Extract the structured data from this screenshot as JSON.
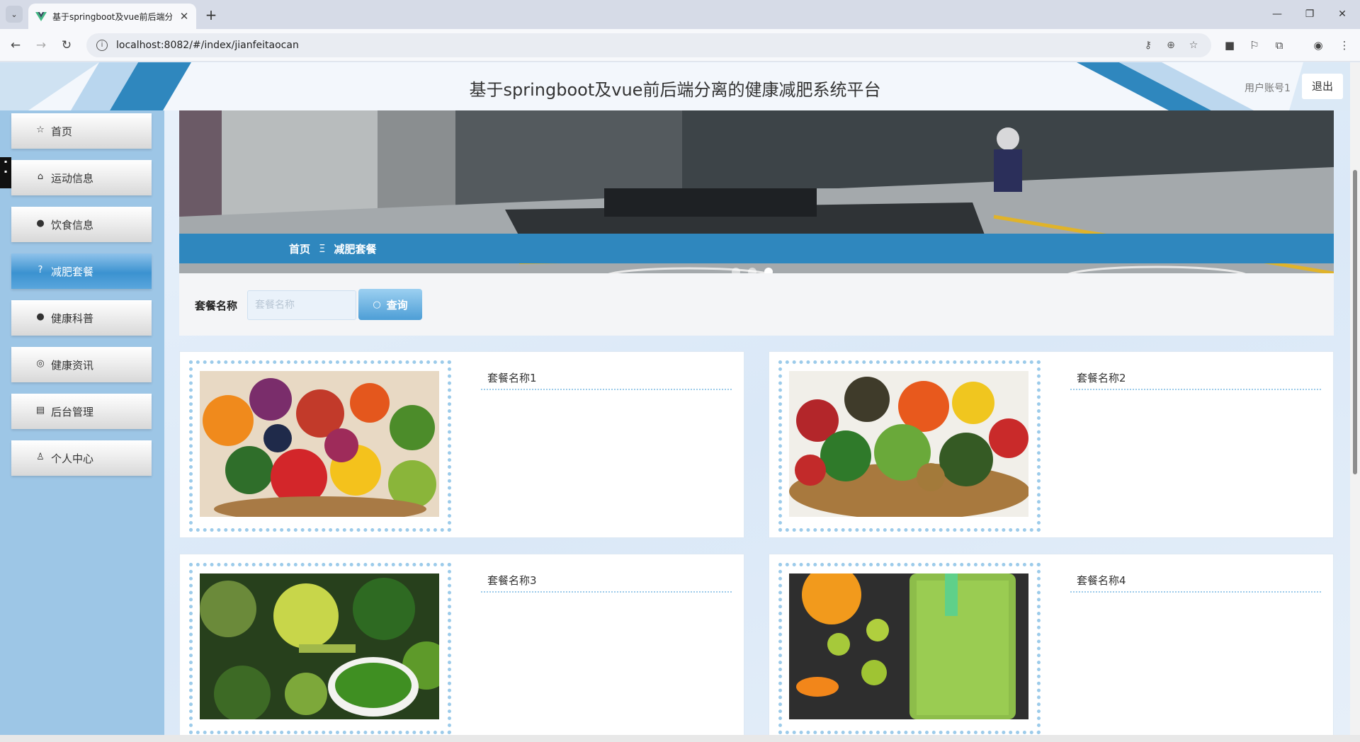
{
  "browser": {
    "tab_title": "基于springboot及vue前后端分",
    "url": "localhost:8082/#/index/jianfeitaocan"
  },
  "header": {
    "title": "基于springboot及vue前后端分离的健康减肥系统平台",
    "user_account": "用户账号1",
    "logout": "退出"
  },
  "sidebar": {
    "items": [
      {
        "label": "首页",
        "icon": "star-icon"
      },
      {
        "label": "运动信息",
        "icon": "bag-icon"
      },
      {
        "label": "饮食信息",
        "icon": "info-circle-icon"
      },
      {
        "label": "减肥套餐",
        "icon": "question-circle-icon",
        "active": true
      },
      {
        "label": "健康科普",
        "icon": "info-circle-icon"
      },
      {
        "label": "健康资讯",
        "icon": "target-icon"
      },
      {
        "label": "后台管理",
        "icon": "clipboard-icon"
      },
      {
        "label": "个人中心",
        "icon": "user-icon"
      }
    ]
  },
  "breadcrumb": {
    "home": "首页",
    "separator": "Ξ",
    "current": "减肥套餐"
  },
  "search": {
    "label": "套餐名称",
    "placeholder": "套餐名称",
    "button": "查询"
  },
  "packages": [
    {
      "name": "套餐名称1"
    },
    {
      "name": "套餐名称2"
    },
    {
      "name": "套餐名称3"
    },
    {
      "name": "套餐名称4"
    }
  ],
  "colors": {
    "primary": "#2f87be",
    "sidebar_bg": "#9dc6e6",
    "card_border": "#9ccbea"
  }
}
